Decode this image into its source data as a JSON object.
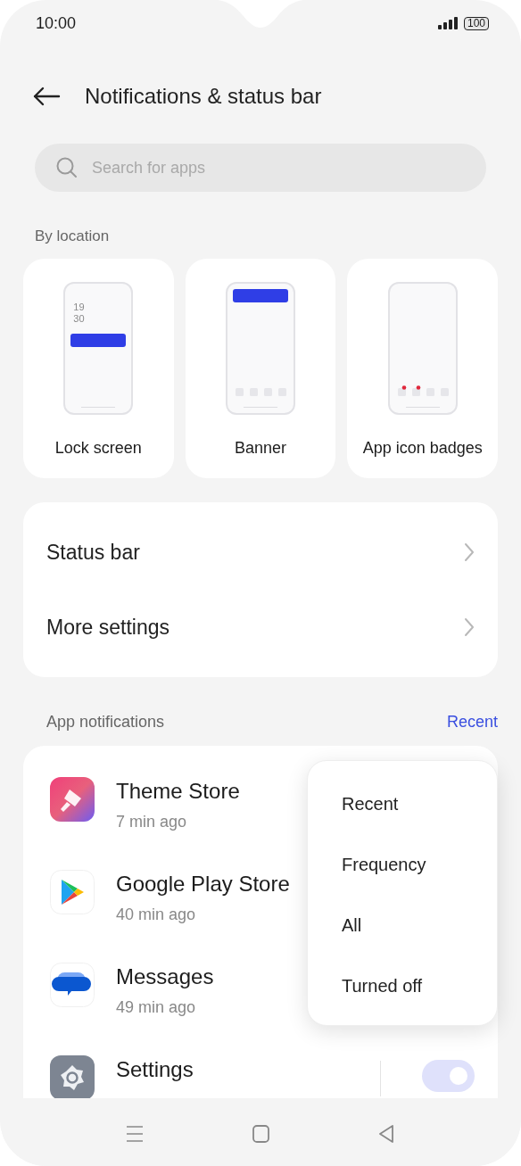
{
  "status_bar": {
    "time": "10:00",
    "battery": "100"
  },
  "header": {
    "title": "Notifications & status bar"
  },
  "search": {
    "placeholder": "Search for apps"
  },
  "by_location": {
    "heading": "By location",
    "options": [
      {
        "label": "Lock screen",
        "kind": "lock",
        "clock": [
          "19",
          "30"
        ]
      },
      {
        "label": "Banner",
        "kind": "banner"
      },
      {
        "label": "App icon badges",
        "kind": "badges"
      }
    ]
  },
  "settings_rows": [
    {
      "label": "Status bar"
    },
    {
      "label": "More settings"
    }
  ],
  "app_notifications": {
    "heading": "App notifications",
    "sort": "Recent",
    "apps": [
      {
        "name": "Theme Store",
        "time": "7 min ago",
        "kind": "theme"
      },
      {
        "name": "Google Play Store",
        "time": "40 min ago",
        "kind": "play"
      },
      {
        "name": "Messages",
        "time": "49 min ago",
        "kind": "messages"
      },
      {
        "name": "Settings",
        "kind": "settings",
        "on": true
      }
    ]
  },
  "sort_menu": {
    "items": [
      "Recent",
      "Frequency",
      "All",
      "Turned off"
    ]
  }
}
